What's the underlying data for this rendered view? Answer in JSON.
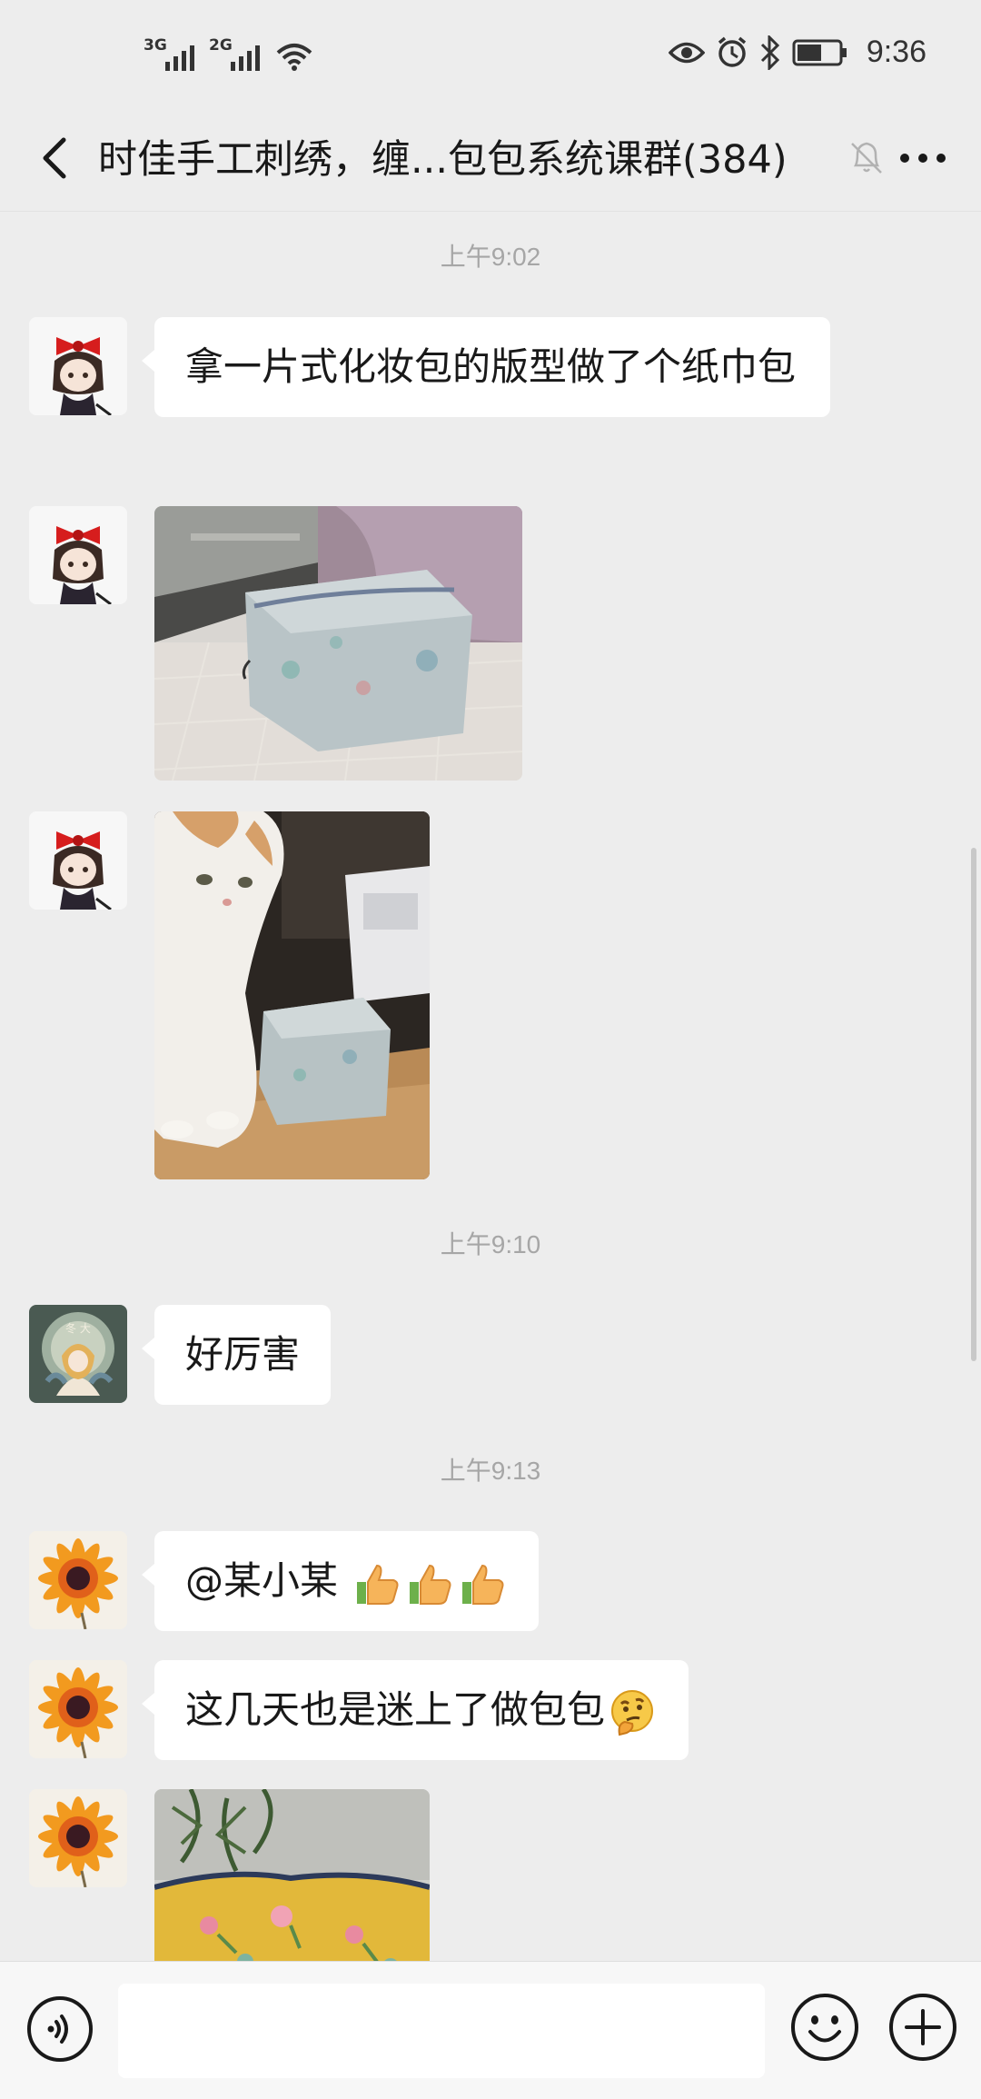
{
  "status_bar": {
    "net1": "3G",
    "net2": "2G",
    "time": "9:36"
  },
  "header": {
    "title": "时佳手工刺绣，缠...包包系统课群(384)"
  },
  "messages": {
    "ts1": "上午9:02",
    "m1_text": "拿一片式化妆包的版型做了个纸巾包",
    "ts2": "上午9:10",
    "m4_text": "好厉害",
    "ts3": "上午9:13",
    "m5_text": "@某小某 ",
    "m6_text": "这几天也是迷上了做包包"
  },
  "icons": {
    "back": "chevron-left-icon",
    "mute": "bell-off-icon",
    "more": "more-dots-icon",
    "voice": "voice-icon",
    "emoji": "smiley-icon",
    "plus": "plus-circle-icon",
    "thumbs": "thumbs-up-emoji",
    "thinking": "thinking-emoji"
  },
  "input": {
    "placeholder": ""
  }
}
